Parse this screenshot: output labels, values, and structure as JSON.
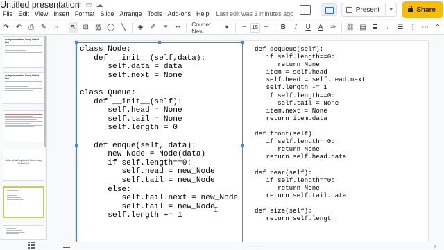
{
  "header": {
    "title": "Untitled presentation",
    "menus": [
      "File",
      "Edit",
      "View",
      "Insert",
      "Format",
      "Slide",
      "Arrange",
      "Tools",
      "Add-ons",
      "Help"
    ],
    "last_edit": "Last edit was 3 minutes ago",
    "present_label": "Present",
    "share_label": "Share"
  },
  "toolbar": {
    "font_name": "Courier New",
    "font_size": "15",
    "bold": "B",
    "italic": "I",
    "underline": "U",
    "text_color": "A",
    "minus": "−",
    "plus": "+"
  },
  "filmstrip": {
    "slides": [
      {
        "title": "ue Implementation Using Linked List",
        "kind": "text",
        "lines": 5
      },
      {
        "title": "ue Implementation Using Linked List",
        "kind": "text",
        "lines": 9
      },
      {
        "title": "",
        "kind": "text-red",
        "lines": 10
      },
      {
        "title": "",
        "kind": "center",
        "center_text": "s after we will implement Queue using Linked List"
      },
      {
        "title": "",
        "kind": "code",
        "lines": 9
      },
      {
        "title": "",
        "kind": "code",
        "lines": 4
      }
    ]
  },
  "slide": {
    "code_left": "class Node:\n   def __init__(self,data):\n      self.data = data\n      self.next = None\n\nclass Queue:\n   def __init__(self):\n      self.head = None\n      self.tail = None\n      self.length = 0\n\n   def enque(self, data):\n      new_Node = Node(data)\n      if self.length==0:\n         self.head = new_Node\n         self.tail = new_Node\n      else:\n         self.tail.next = new_Node\n         self.tail = new_Node\n      self.length += 1",
    "code_right": "def dequeue(self):\n   if self.length==0:\n      return None\n   item = self.head\n   self.head = self.head.next\n   self.length -= 1\n   if self.length==0:\n      self.tail = None\n   item.next = None\n   return item.data\n\ndef front(self):\n   if self.length==0:\n      return None\n   return self.head.data\n\ndef rear(self):\n   if self.length==0:\n      return None\n   return self.tail.data\n\ndef size(self):\n   return self.length"
  },
  "colors": {
    "selection": "#4285f4",
    "share": "#fbbc04",
    "active_thumb": "#c6d24e"
  }
}
